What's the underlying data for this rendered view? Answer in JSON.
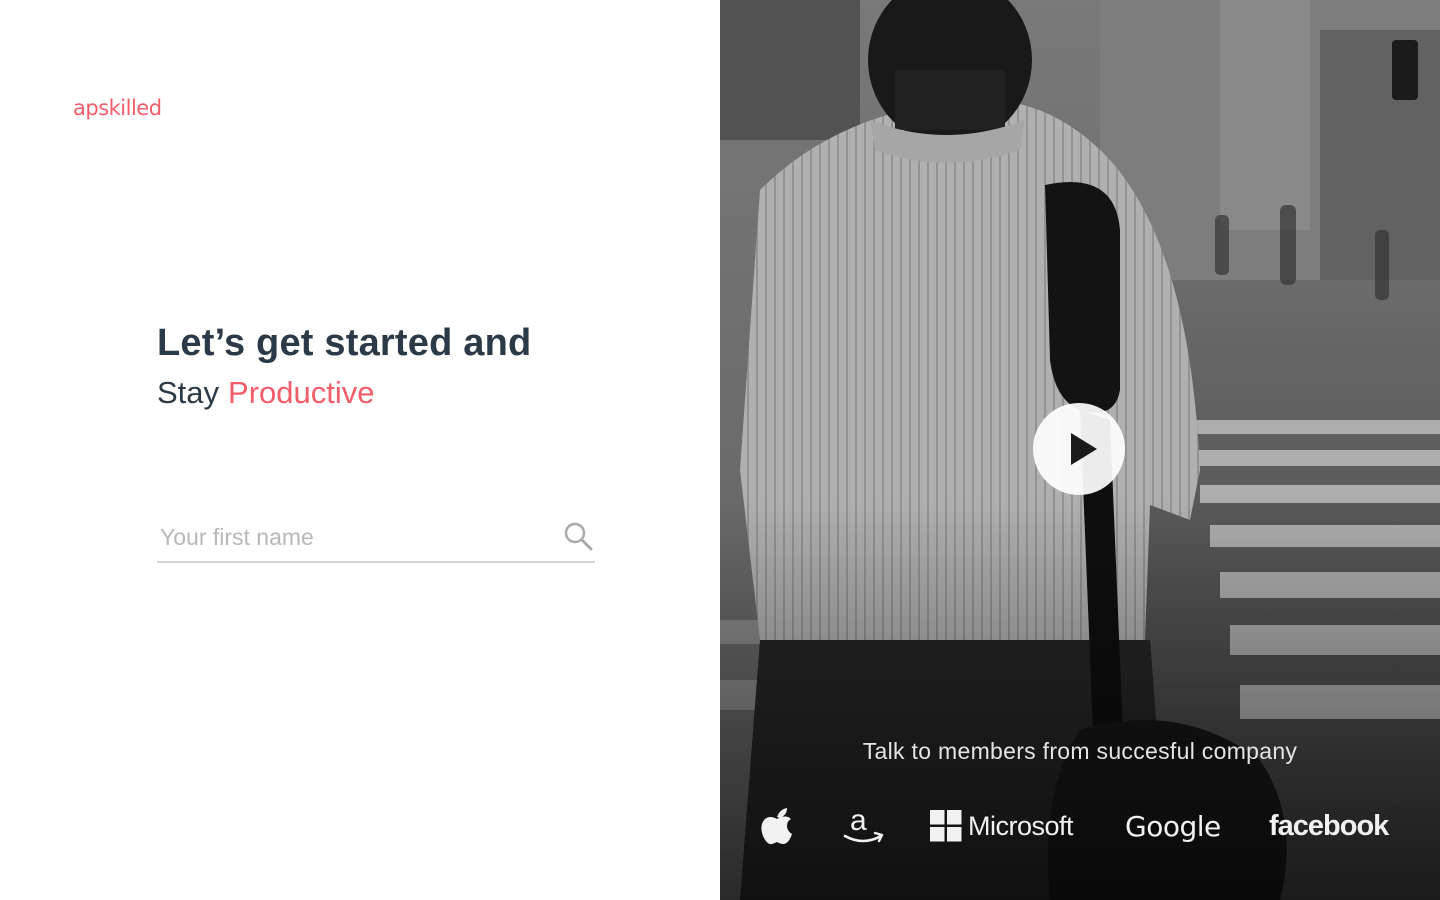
{
  "brand": {
    "name": "apskilled",
    "accent_color": "#f25d6a"
  },
  "hero": {
    "line1": "Let’s get started and",
    "line2_prefix": "Stay",
    "line2_accent": "Productive"
  },
  "form": {
    "first_name_placeholder": "Your first name",
    "first_name_value": "",
    "search_icon": "search-icon"
  },
  "media": {
    "play_icon": "play-icon",
    "tagline": "Talk to members from succesful company",
    "companies": [
      {
        "name": "Apple",
        "icon": "apple-logo-icon"
      },
      {
        "name": "Amazon",
        "icon": "amazon-logo-icon"
      },
      {
        "name": "Microsoft",
        "icon": "microsoft-logo-icon"
      },
      {
        "name": "Google",
        "icon": "google-logo-icon"
      },
      {
        "name": "facebook",
        "icon": "facebook-logo-icon"
      }
    ]
  },
  "colors": {
    "heading": "#2c3a47",
    "accent": "#f25d6a",
    "placeholder": "#b8b8b8",
    "underline": "#d4d4d4"
  }
}
